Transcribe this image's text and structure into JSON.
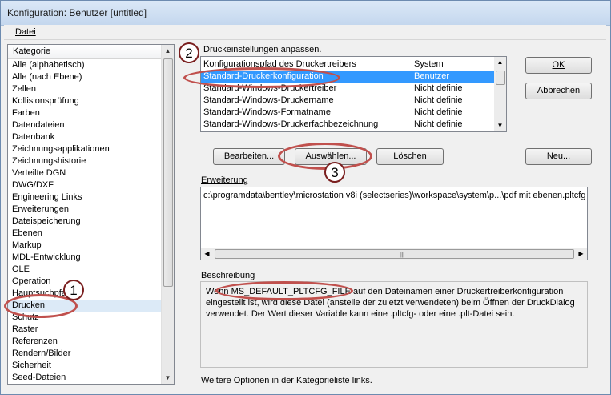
{
  "window": {
    "title": "Konfiguration: Benutzer [untitled]"
  },
  "menu": {
    "datei": "Datei"
  },
  "categories": {
    "header": "Kategorie",
    "items": [
      "Alle (alphabetisch)",
      "Alle (nach Ebene)",
      "Zellen",
      "Kollisionsprüfung",
      "Farben",
      "Datendateien",
      "Datenbank",
      "Zeichnungsapplikationen",
      "Zeichnungshistorie",
      "Verteilte DGN",
      "DWG/DXF",
      "Engineering Links",
      "Erweiterungen",
      "Dateispeicherung",
      "Ebenen",
      "Markup",
      "MDL-Entwicklung",
      "OLE",
      "Operation",
      "Hauptsuchpfade",
      "Drucken",
      "Schutz",
      "Raster",
      "Referenzen",
      "Rendern/Bilder",
      "Sicherheit",
      "Seed-Dateien"
    ],
    "selected": "Drucken"
  },
  "main": {
    "heading": "Druckeinstellungen anpassen.",
    "rows": [
      {
        "name": "Konfigurationspfad des Druckertreibers",
        "level": "System"
      },
      {
        "name": "Standard-Druckerkonfiguration",
        "level": "Benutzer"
      },
      {
        "name": "Standard-Windows-Druckertreiber",
        "level": "Nicht definie"
      },
      {
        "name": "Standard-Windows-Druckername",
        "level": "Nicht definie"
      },
      {
        "name": "Standard-Windows-Formatname",
        "level": "Nicht definie"
      },
      {
        "name": "Standard-Windows-Druckerfachbezeichnung",
        "level": "Nicht definie"
      }
    ],
    "buttons": {
      "bearbeiten": "Bearbeiten...",
      "auswaehlen": "Auswählen...",
      "loeschen": "Löschen",
      "neu": "Neu..."
    },
    "erweiterung_label": "Erweiterung",
    "erweiterung_value": "c:\\programdata\\bentley\\microstation v8i (selectseries)\\workspace\\system\\p...\\pdf mit ebenen.pltcfg",
    "beschreibung_label": "Beschreibung",
    "beschreibung_text": "Wenn MS_DEFAULT_PLTCFG_FILE auf den Dateinamen einer Druckertreiberkonfiguration eingestellt ist, wird diese Datei (anstelle der zuletzt verwendeten) beim Öffnen der DruckDialog verwendet. Der Wert dieser Variable kann eine .pltcfg- oder eine .plt-Datei sein.",
    "footer_hint": "Weitere Optionen in der Kategorieliste links."
  },
  "dialog_buttons": {
    "ok": "OK",
    "abbrechen": "Abbrechen"
  },
  "annotations": {
    "n1": "1",
    "n2": "2",
    "n3": "3",
    "color": "#c0504d"
  }
}
